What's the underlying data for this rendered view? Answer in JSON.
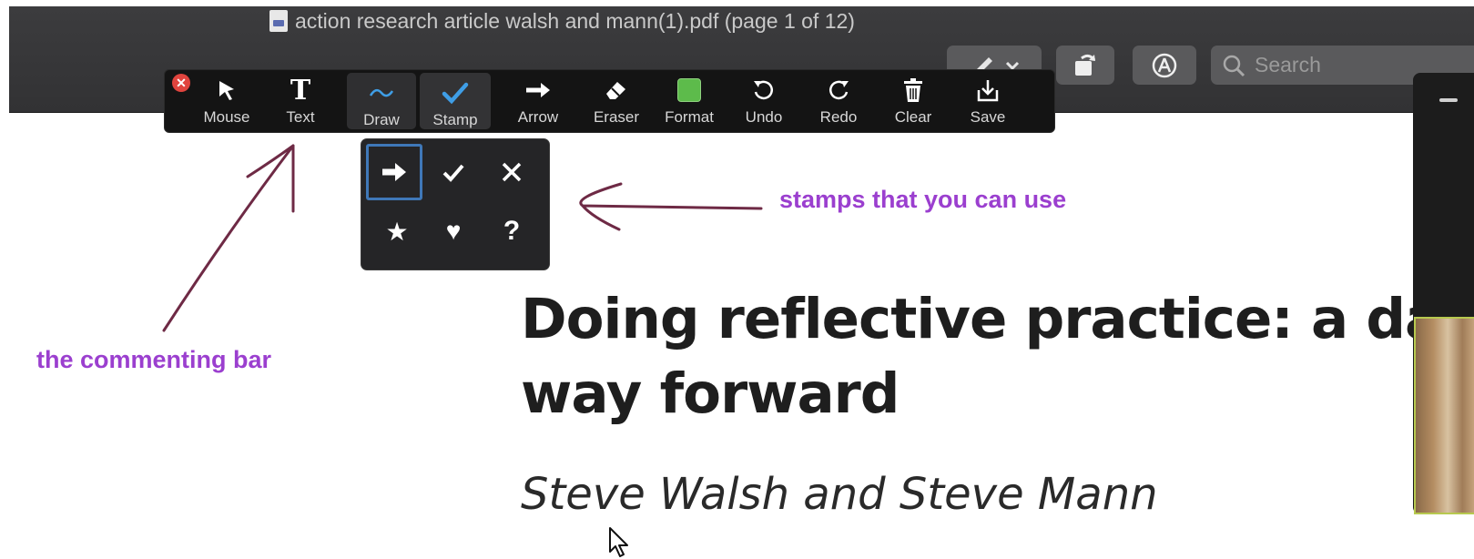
{
  "window": {
    "title": "action research article walsh and mann(1).pdf (page 1 of 12)",
    "search_placeholder": "Search"
  },
  "toolbar": {
    "tools": [
      {
        "label": "Mouse",
        "icon": "cursor-arrow-icon"
      },
      {
        "label": "Text",
        "icon": "text-t-icon"
      },
      {
        "label": "Draw",
        "icon": "squiggle-draw-icon"
      },
      {
        "label": "Stamp",
        "icon": "checkmark-stamp-icon"
      },
      {
        "label": "Arrow",
        "icon": "right-arrow-icon"
      },
      {
        "label": "Eraser",
        "icon": "eraser-icon"
      },
      {
        "label": "Format",
        "icon": "color-swatch-icon"
      },
      {
        "label": "Undo",
        "icon": "undo-icon"
      },
      {
        "label": "Redo",
        "icon": "redo-icon"
      },
      {
        "label": "Clear",
        "icon": "trash-icon"
      },
      {
        "label": "Save",
        "icon": "save-download-icon"
      }
    ],
    "selected_tool": "Stamp",
    "format_color": "#5dbb4b",
    "accent_color": "#3f9ee6"
  },
  "stamps": {
    "items": [
      "right-arrow-stamp",
      "checkmark-stamp",
      "x-stamp",
      "star-stamp",
      "heart-stamp",
      "question-stamp"
    ],
    "selected": "right-arrow-stamp"
  },
  "annotations": {
    "stamps_note": "stamps that you can use",
    "bar_note": "the commenting bar",
    "color": "#9b3fcf",
    "arrow_color": "#6e2a45"
  },
  "document": {
    "heading_line1": "Doing reflective practice: a data-",
    "heading_line2": "way forward",
    "authors": "Steve Walsh and Steve Mann"
  }
}
